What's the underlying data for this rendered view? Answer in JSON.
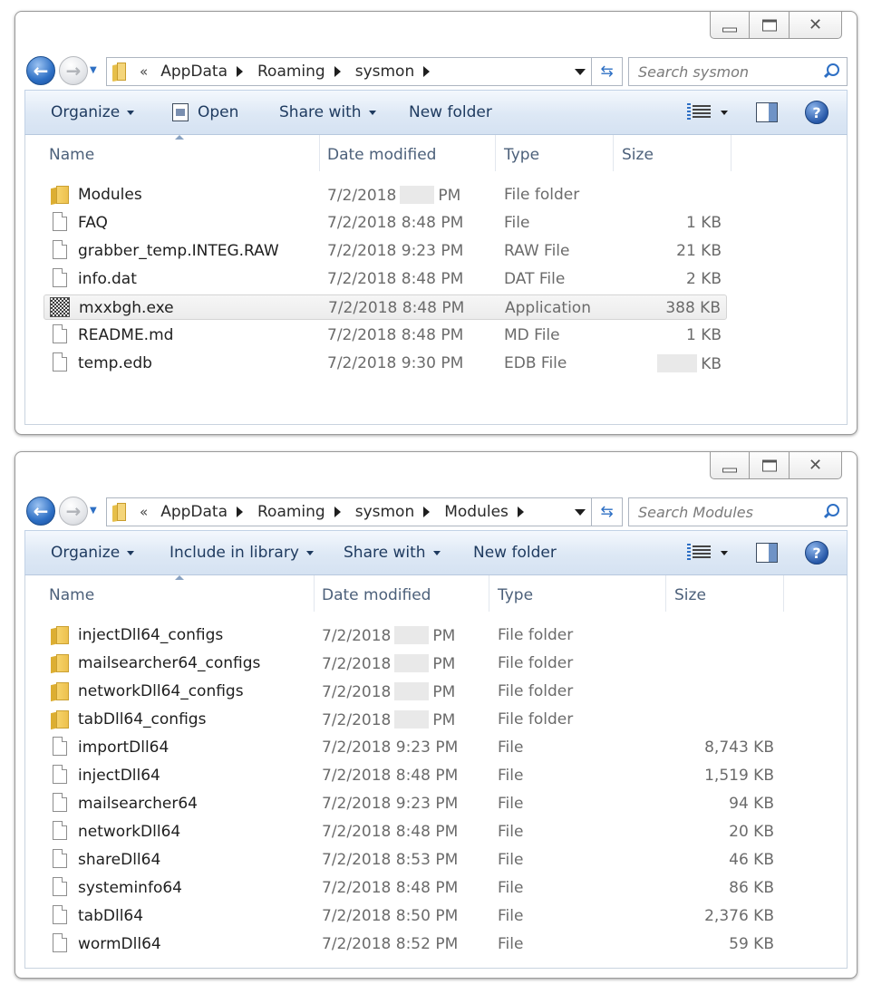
{
  "windows": [
    {
      "breadcrumb": [
        "AppData",
        "Roaming",
        "sysmon"
      ],
      "search_placeholder": "Search sysmon",
      "commands": {
        "organize": "Organize",
        "open": "Open",
        "share_with": "Share with",
        "new_folder": "New folder"
      },
      "columns": {
        "name": "Name",
        "date": "Date modified",
        "type": "Type",
        "size": "Size"
      },
      "rows": [
        {
          "name": "Modules",
          "kind": "folder",
          "date": "7/2/2018",
          "time_redacted": true,
          "ampm": "PM",
          "type": "File folder",
          "size": ""
        },
        {
          "name": "FAQ",
          "kind": "file",
          "date": "7/2/2018 8:48 PM",
          "type": "File",
          "size": "1 KB"
        },
        {
          "name": "grabber_temp.INTEG.RAW",
          "kind": "file",
          "date": "7/2/2018 9:23 PM",
          "type": "RAW File",
          "size": "21 KB"
        },
        {
          "name": "info.dat",
          "kind": "file",
          "date": "7/2/2018 8:48 PM",
          "type": "DAT File",
          "size": "2 KB"
        },
        {
          "name": "mxxbgh.exe",
          "kind": "exe",
          "date": "7/2/2018 8:48 PM",
          "type": "Application",
          "size": "388 KB",
          "selected": true
        },
        {
          "name": "README.md",
          "kind": "file",
          "date": "7/2/2018 8:48 PM",
          "type": "MD File",
          "size": "1 KB"
        },
        {
          "name": "temp.edb",
          "kind": "file",
          "date": "7/2/2018 9:30 PM",
          "type": "EDB File",
          "size": "KB",
          "size_redacted": true
        }
      ]
    },
    {
      "breadcrumb": [
        "AppData",
        "Roaming",
        "sysmon",
        "Modules"
      ],
      "search_placeholder": "Search Modules",
      "commands": {
        "organize": "Organize",
        "include_in_library": "Include in library",
        "share_with": "Share with",
        "new_folder": "New folder"
      },
      "columns": {
        "name": "Name",
        "date": "Date modified",
        "type": "Type",
        "size": "Size"
      },
      "rows": [
        {
          "name": "injectDll64_configs",
          "kind": "folder",
          "date": "7/2/2018",
          "time_redacted": true,
          "ampm": "PM",
          "type": "File folder",
          "size": ""
        },
        {
          "name": "mailsearcher64_configs",
          "kind": "folder",
          "date": "7/2/2018",
          "time_redacted": true,
          "ampm": "PM",
          "type": "File folder",
          "size": ""
        },
        {
          "name": "networkDll64_configs",
          "kind": "folder",
          "date": "7/2/2018",
          "time_redacted": true,
          "ampm": "PM",
          "type": "File folder",
          "size": ""
        },
        {
          "name": "tabDll64_configs",
          "kind": "folder",
          "date": "7/2/2018",
          "time_redacted": true,
          "ampm": "PM",
          "type": "File folder",
          "size": ""
        },
        {
          "name": "importDll64",
          "kind": "file",
          "date": "7/2/2018 9:23 PM",
          "type": "File",
          "size": "8,743 KB"
        },
        {
          "name": "injectDll64",
          "kind": "file",
          "date": "7/2/2018 8:48 PM",
          "type": "File",
          "size": "1,519 KB"
        },
        {
          "name": "mailsearcher64",
          "kind": "file",
          "date": "7/2/2018 9:23 PM",
          "type": "File",
          "size": "94 KB"
        },
        {
          "name": "networkDll64",
          "kind": "file",
          "date": "7/2/2018 8:48 PM",
          "type": "File",
          "size": "20 KB"
        },
        {
          "name": "shareDll64",
          "kind": "file",
          "date": "7/2/2018 8:53 PM",
          "type": "File",
          "size": "46 KB"
        },
        {
          "name": "systeminfo64",
          "kind": "file",
          "date": "7/2/2018 8:48 PM",
          "type": "File",
          "size": "86 KB"
        },
        {
          "name": "tabDll64",
          "kind": "file",
          "date": "7/2/2018 8:50 PM",
          "type": "File",
          "size": "2,376 KB"
        },
        {
          "name": "wormDll64",
          "kind": "file",
          "date": "7/2/2018 8:52 PM",
          "type": "File",
          "size": "59 KB"
        }
      ]
    }
  ],
  "icons": {
    "back": "back-arrow-icon",
    "forward": "forward-arrow-icon",
    "refresh": "refresh-icon",
    "search": "search-icon",
    "views": "views-icon",
    "preview_pane": "preview-pane-icon",
    "help": "help-icon"
  },
  "glyphs": {
    "back_arrow": "←",
    "forward_arrow": "→",
    "recent_dropdown": "▼",
    "breadcrumb_overflow": "«",
    "refresh": "⇆",
    "close": "✕",
    "help": "?"
  },
  "colors": {
    "command_bar_top": "#f4f8fd",
    "command_bar_bottom": "#d5e2f2",
    "back_button": "#2d6fc4",
    "header_text": "#4c607a",
    "folder": "#edc14e"
  }
}
